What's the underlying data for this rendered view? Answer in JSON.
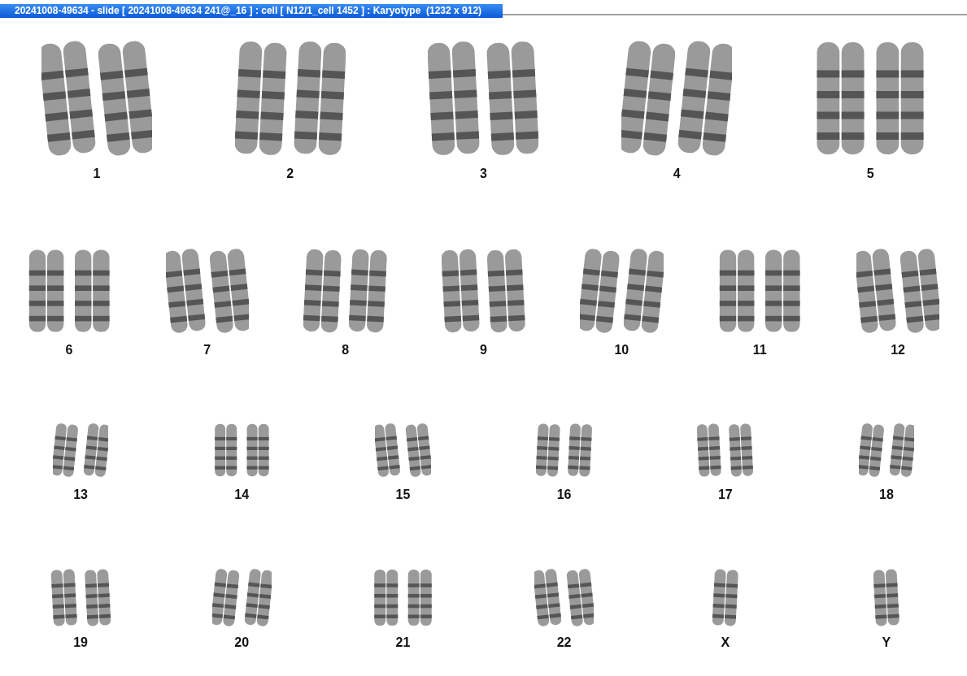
{
  "window": {
    "title": "20241008-49634 - slide [ 20241008-49634 241@_16 ] : cell [ N12/1_cell 1452 ] : Karyotype  (1232 x 912)"
  },
  "karyotype": {
    "rows": [
      [
        {
          "label": "1",
          "kind": "pair"
        },
        {
          "label": "2",
          "kind": "pair"
        },
        {
          "label": "3",
          "kind": "pair"
        },
        {
          "label": "4",
          "kind": "pair"
        },
        {
          "label": "5",
          "kind": "pair"
        }
      ],
      [
        {
          "label": "6",
          "kind": "pair"
        },
        {
          "label": "7",
          "kind": "pair"
        },
        {
          "label": "8",
          "kind": "pair"
        },
        {
          "label": "9",
          "kind": "pair"
        },
        {
          "label": "10",
          "kind": "pair"
        },
        {
          "label": "11",
          "kind": "pair"
        },
        {
          "label": "12",
          "kind": "pair"
        }
      ],
      [
        {
          "label": "13",
          "kind": "pair"
        },
        {
          "label": "14",
          "kind": "pair"
        },
        {
          "label": "15",
          "kind": "pair"
        },
        {
          "label": "16",
          "kind": "pair"
        },
        {
          "label": "17",
          "kind": "pair"
        },
        {
          "label": "18",
          "kind": "pair"
        }
      ],
      [
        {
          "label": "19",
          "kind": "pair"
        },
        {
          "label": "20",
          "kind": "pair"
        },
        {
          "label": "21",
          "kind": "pair"
        },
        {
          "label": "22",
          "kind": "pair"
        },
        {
          "label": "X",
          "kind": "single"
        },
        {
          "label": "Y",
          "kind": "single"
        }
      ]
    ]
  }
}
